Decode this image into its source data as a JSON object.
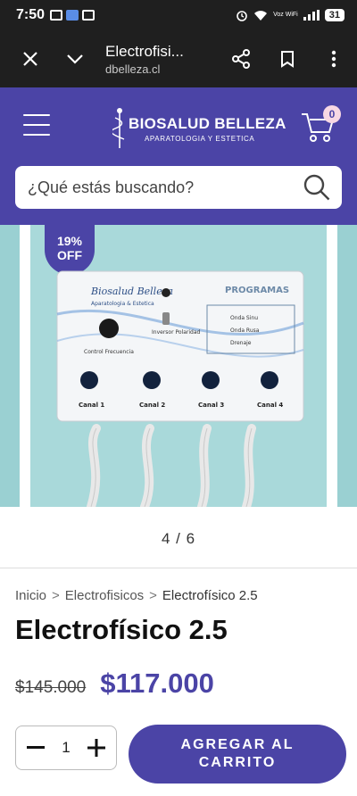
{
  "status_bar": {
    "time": "7:50",
    "network_label": "Voz WiFi",
    "battery": "31"
  },
  "browser": {
    "title": "Electrofisi...",
    "url": "dbelleza.cl"
  },
  "header": {
    "brand": "BIOSALUD BELLEZA",
    "tagline": "APARATOLOGIA Y ESTETICA",
    "cart_count": "0",
    "search_placeholder": "¿Qué estás buscando?"
  },
  "carousel": {
    "discount_badge": "19% OFF",
    "pager": "4 / 6",
    "device_label": {
      "brand": "Biosalud Belleza",
      "sub": "Aparatologia & Estetica",
      "programs_title": "PROGRAMAS",
      "programs": [
        "Onda Sinu",
        "Onda Rusa",
        "Drenaje"
      ],
      "inversor": "Inversor Polaridad",
      "control": "Control Frecuencia",
      "channels": [
        "Canal 1",
        "Canal 2",
        "Canal 3",
        "Canal 4"
      ]
    }
  },
  "breadcrumb": {
    "items": [
      "Inicio",
      "Electrofisicos",
      "Electrofísico 2.5"
    ],
    "separator": ">"
  },
  "product": {
    "title": "Electrofísico 2.5",
    "old_price": "$145.000",
    "new_price": "$117.000",
    "quantity": "1",
    "add_to_cart": "AGREGAR AL CARRITO"
  },
  "colors": {
    "brand": "#4b44a6",
    "browser_bar": "#1f1f1f",
    "image_bg": "#a9d9da"
  }
}
